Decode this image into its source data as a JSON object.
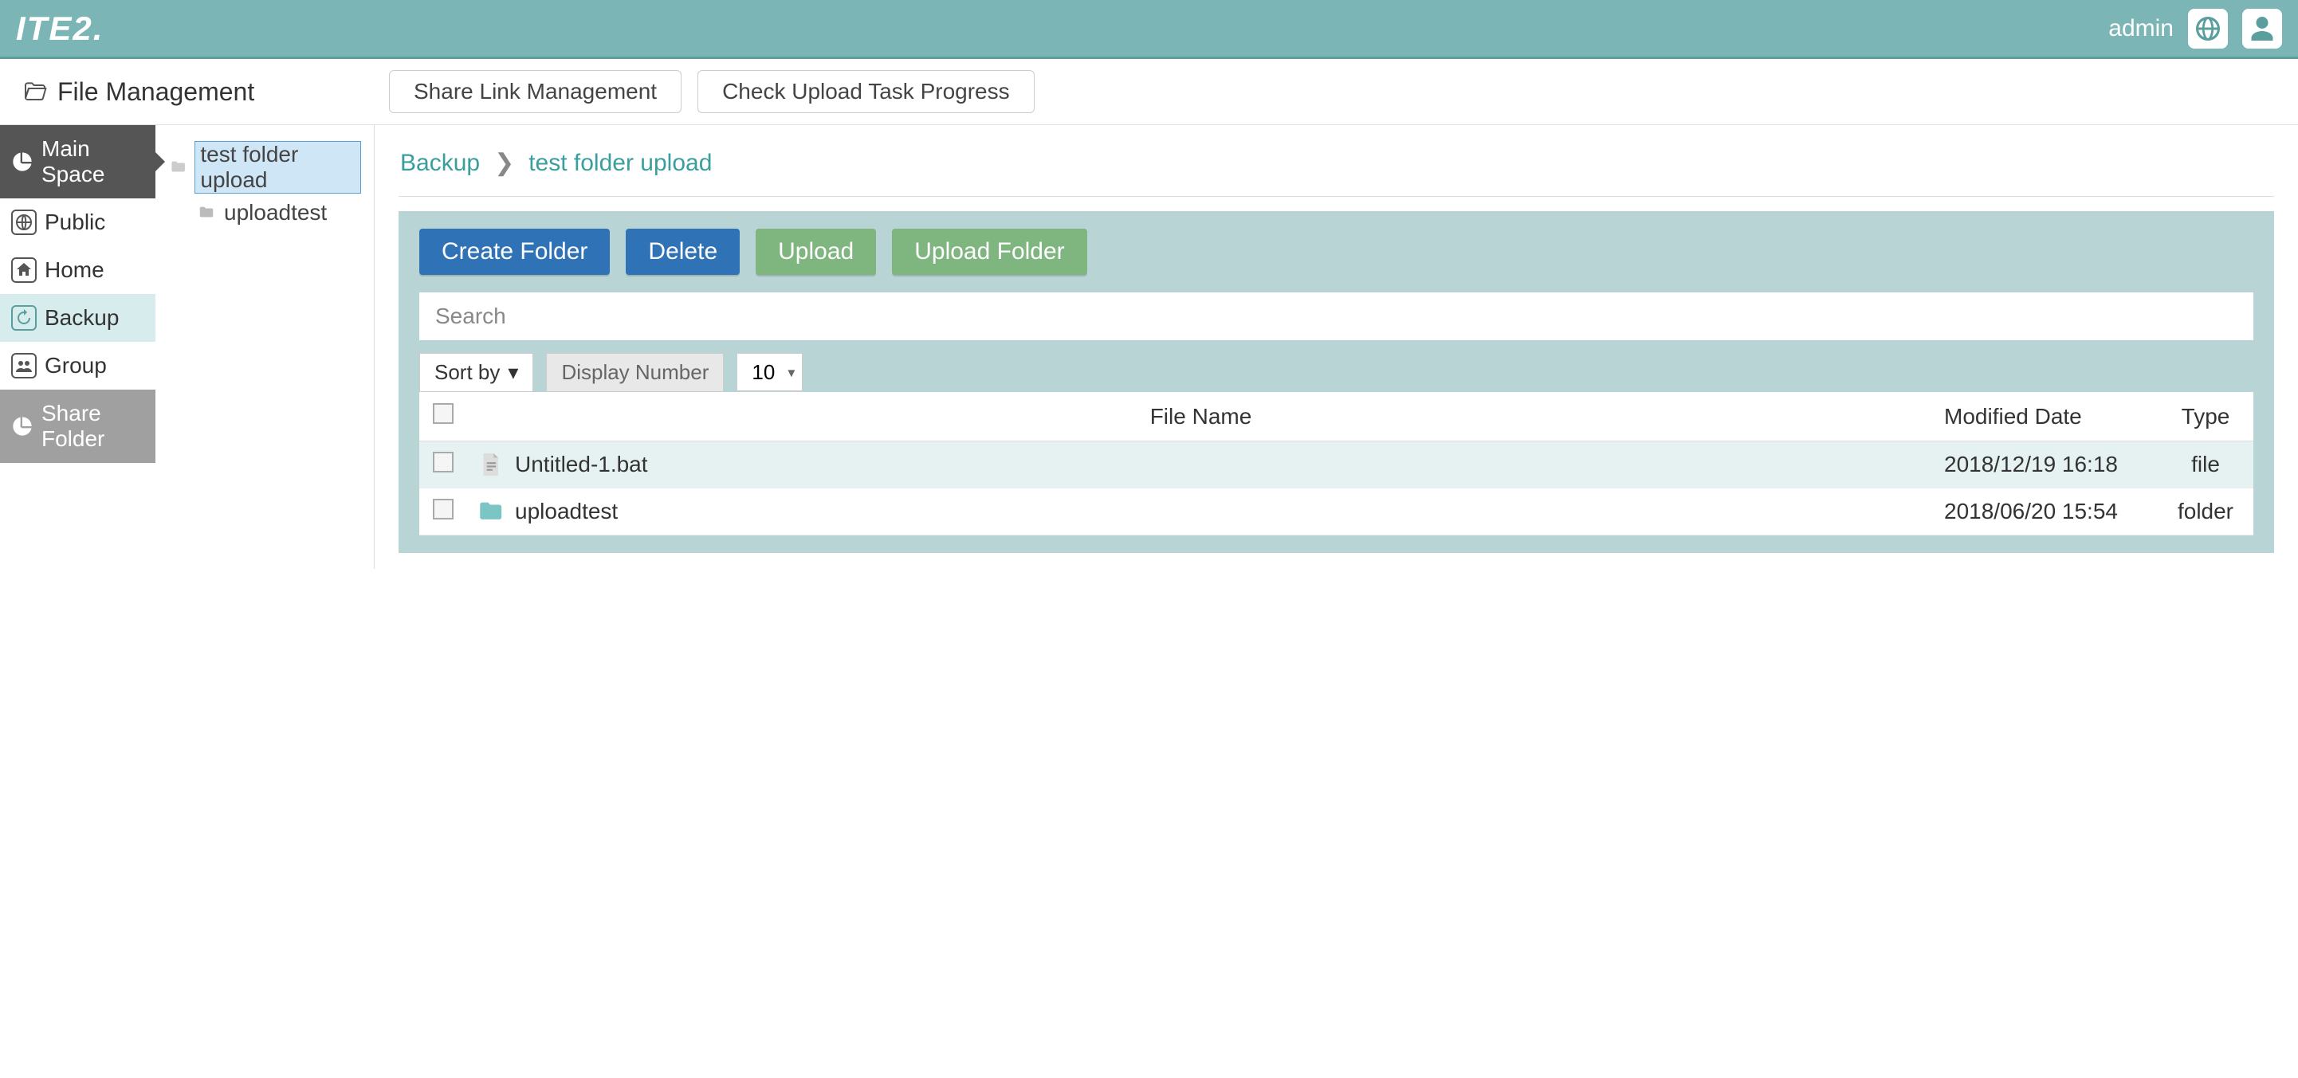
{
  "header": {
    "logo": "ITE2.",
    "user": "admin"
  },
  "subheader": {
    "title": "File Management",
    "btn_share_link": "Share Link Management",
    "btn_check_upload": "Check Upload Task Progress"
  },
  "sidebar": {
    "items": [
      {
        "label": "Main Space",
        "key": "main-space"
      },
      {
        "label": "Public",
        "key": "public"
      },
      {
        "label": "Home",
        "key": "home"
      },
      {
        "label": "Backup",
        "key": "backup"
      },
      {
        "label": "Group",
        "key": "group"
      },
      {
        "label": "Share Folder",
        "key": "share-folder"
      }
    ]
  },
  "tree": {
    "root": "test folder upload",
    "children": [
      {
        "label": "uploadtest"
      }
    ]
  },
  "breadcrumb": {
    "items": [
      "Backup",
      "test folder upload"
    ]
  },
  "toolbar": {
    "create_folder": "Create Folder",
    "delete": "Delete",
    "upload": "Upload",
    "upload_folder": "Upload Folder",
    "search_placeholder": "Search",
    "sort_by": "Sort by",
    "display_number": "Display Number",
    "display_value": "10"
  },
  "table": {
    "headers": {
      "filename": "File Name",
      "modified": "Modified Date",
      "type": "Type"
    },
    "rows": [
      {
        "name": "Untitled-1.bat",
        "modified": "2018/12/19 16:18",
        "type": "file",
        "kind": "file"
      },
      {
        "name": "uploadtest",
        "modified": "2018/06/20 15:54",
        "type": "folder",
        "kind": "folder"
      }
    ]
  }
}
